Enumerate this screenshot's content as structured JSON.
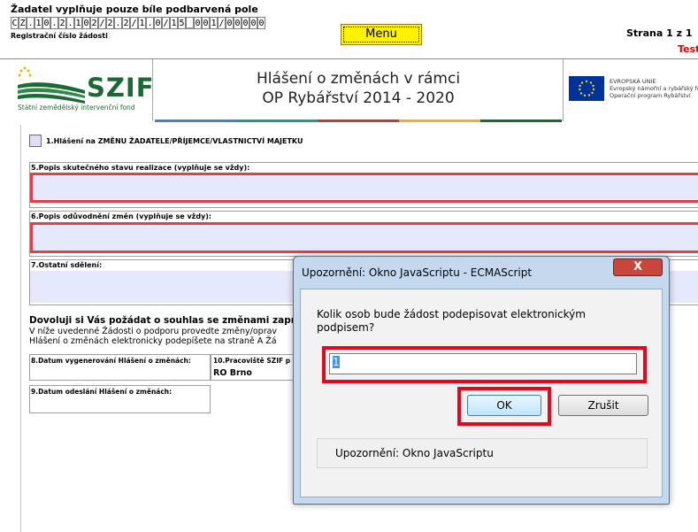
{
  "header": {
    "instruction": "Žadatel vyplňuje pouze bíle podbarvená pole",
    "reg_chars": [
      "C",
      "Z",
      ".",
      "1",
      "0",
      ".",
      "2",
      ".",
      "1",
      "0",
      "2",
      "/",
      "2",
      ".",
      "2",
      "/",
      "1",
      ".",
      "0",
      "/",
      "1",
      "5",
      "_",
      "0",
      "0",
      "1",
      "/",
      "0",
      "0",
      "0",
      "0",
      "0"
    ],
    "reg_label": "Registrační číslo žádosti",
    "menu_label": "Menu",
    "page_label": "Strana 1 z 1",
    "test_label": "Test"
  },
  "logo": {
    "name": "SZIF",
    "subtitle": "Státní zemědělský intervenční fond"
  },
  "title": {
    "line1": "Hlášení o změnách v rámci",
    "line2": "OP Rybářství 2014 - 2020"
  },
  "eu": {
    "line1": "EVROPSKÁ UNIE",
    "line2": "Evropský námořní a rybářský fond",
    "line3": "Operační program Rybářství"
  },
  "colors": {
    "bar": [
      "#4a7fc1",
      "#1e9b8a",
      "#c03a3a",
      "#e6b42c",
      "#1b6a34"
    ],
    "red_highlight": "#e2081e",
    "field_bg": "#e6e8fb"
  },
  "form": {
    "checkbox_label": "1.Hlášení na ZMĚNU ŽADATELE/PŘÍJEMCE/VLASTNICTVÍ MAJETKU",
    "field5_label": "5.Popis skutečného stavu realizace (vyplňuje se vždy):",
    "field6_label": "6.Popis odůvodnění změn (vyplňuje se vždy):",
    "field7_label": "7.Ostatní sdělení:",
    "consent_title": "Dovoluji si Vás požádat o souhlas se změnami zapra",
    "consent_line1": "V níže uvedenné Žádosti o podporu provedte změny/oprav",
    "consent_line2": "Hlášení o změnách elektronicky podepíšete na straně A Žá",
    "field8_label": "8.Datum vygenerování Hlášení o změnách:",
    "field10_label": "10.Pracoviště SZIF p",
    "field10_value": "RO Brno",
    "field9_label": "9.Datum odeslání Hlášení o změnách:"
  },
  "dialog": {
    "title": "Upozornění: Okno JavaScriptu - ECMAScript",
    "close_glyph": "X",
    "prompt": "Kolik osob bude žádost podepisovat elektronickým podpisem?",
    "input_value": "1",
    "ok_label": "OK",
    "cancel_label": "Zrušit",
    "footer_label": "Upozornění: Okno JavaScriptu"
  }
}
